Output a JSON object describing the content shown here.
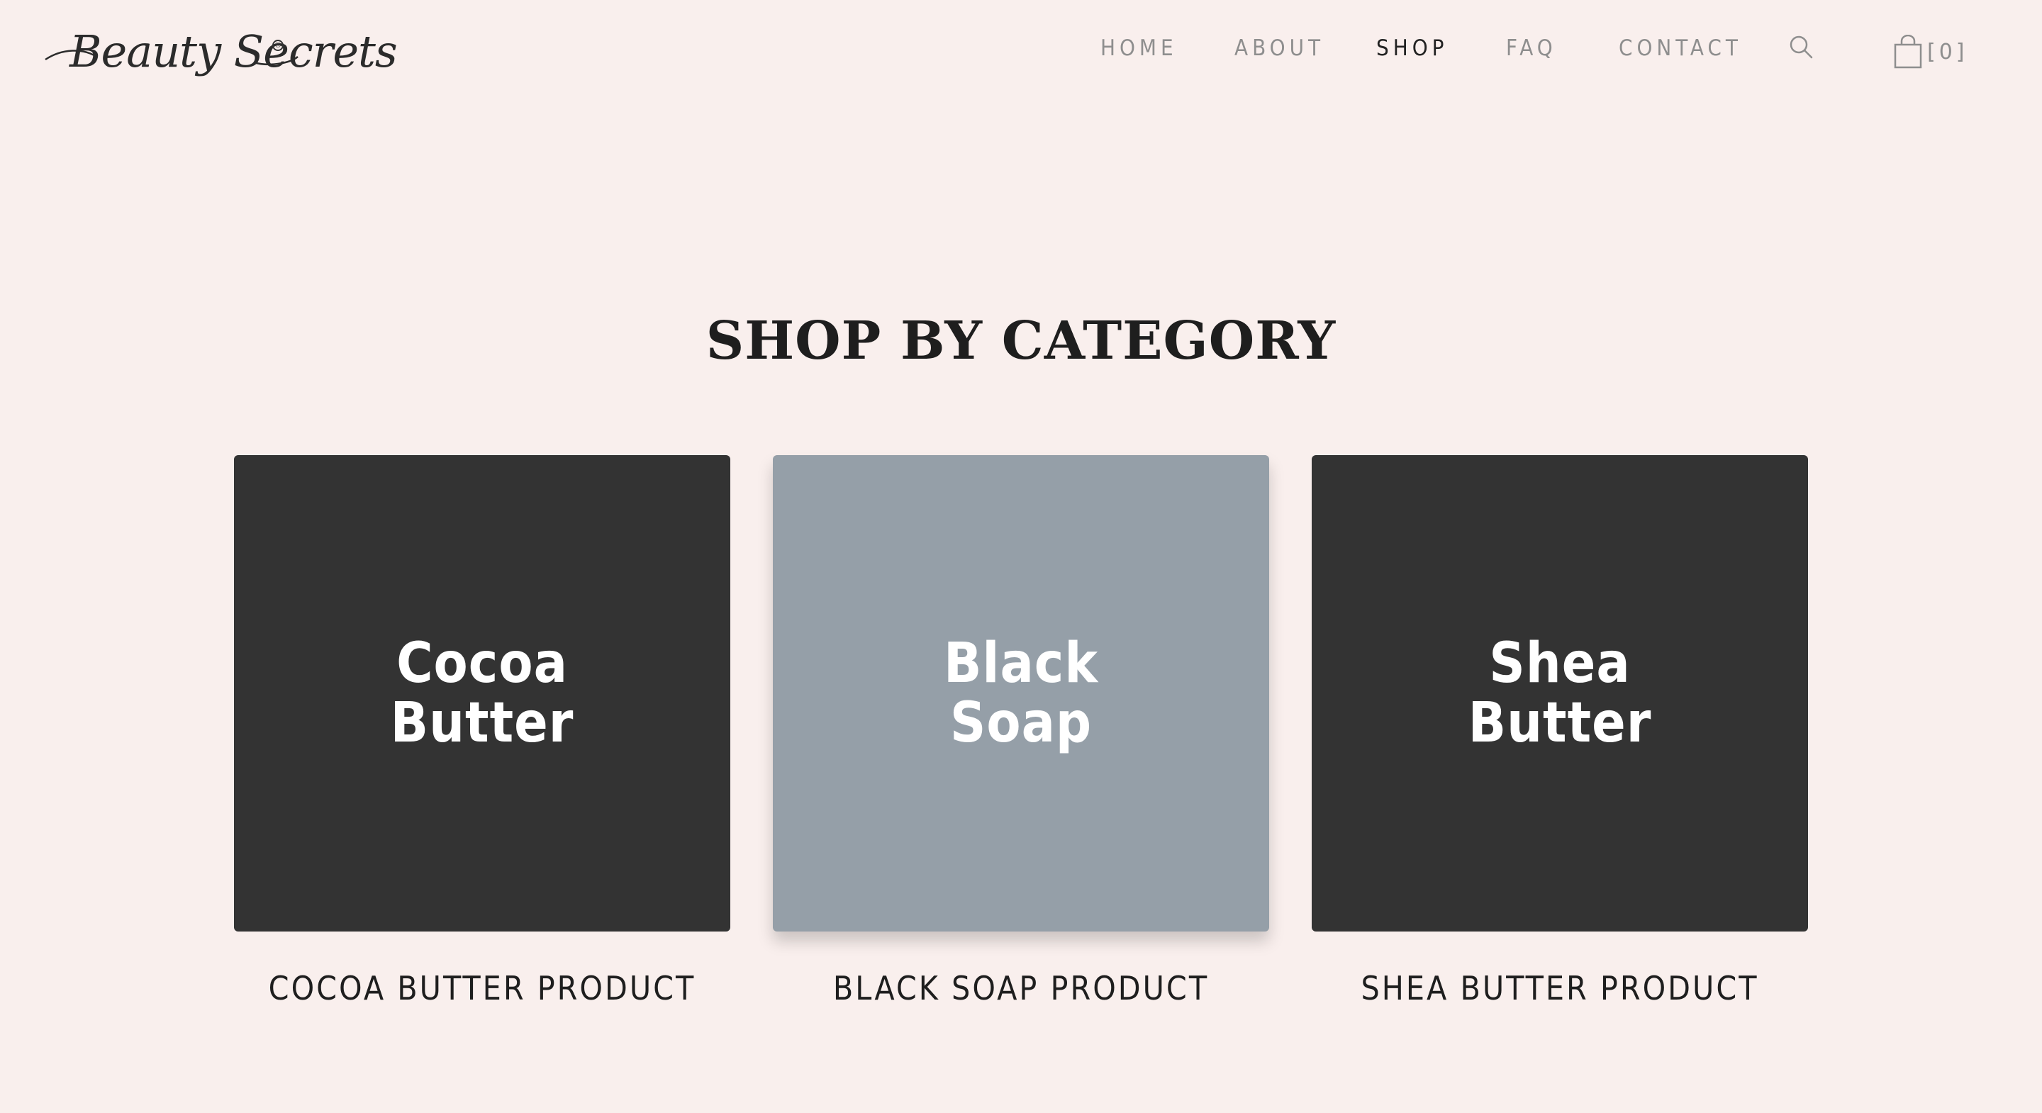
{
  "brand": {
    "logo_text": "Beauty Secrets",
    "registered_mark": "®"
  },
  "nav": {
    "items": [
      {
        "label": "HOME",
        "active": false
      },
      {
        "label": "ABOUT",
        "active": false
      },
      {
        "label": "SHOP",
        "active": true
      },
      {
        "label": "FAQ",
        "active": false
      },
      {
        "label": "CONTACT",
        "active": false
      }
    ],
    "search_icon": "search-icon",
    "cart_icon": "shopping-bag-icon",
    "cart_count": "[0]"
  },
  "section": {
    "title": "SHOP BY CATEGORY"
  },
  "categories": [
    {
      "line1": "Cocoa",
      "line2": "Butter",
      "caption": "COCOA BUTTER PRODUCT",
      "color": "#333333"
    },
    {
      "line1": "Black",
      "line2": "Soap",
      "caption": "BLACK SOAP PRODUCT",
      "color": "#959fa8"
    },
    {
      "line1": "Shea",
      "line2": "Butter",
      "caption": "SHEA BUTTER PRODUCT",
      "color": "#333333"
    }
  ],
  "colors": {
    "background": "#f9efed",
    "nav_inactive": "#8e8e8e",
    "nav_active": "#222222",
    "card_dark": "#333333",
    "card_hover": "#959fa8"
  }
}
